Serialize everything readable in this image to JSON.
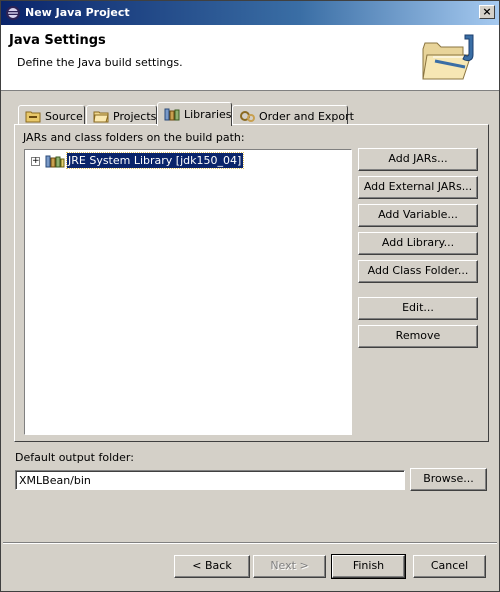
{
  "window": {
    "title": "New Java Project",
    "close_glyph": "×"
  },
  "header": {
    "title": "Java Settings",
    "description": "Define the Java build settings.",
    "icon": "java-project-folder-icon"
  },
  "tabs": [
    {
      "label": "Source",
      "icon": "source-folder-icon",
      "active": false
    },
    {
      "label": "Projects",
      "icon": "projects-icon",
      "active": false
    },
    {
      "label": "Libraries",
      "icon": "libraries-icon",
      "active": true
    },
    {
      "label": "Order and Export",
      "icon": "order-export-icon",
      "active": false
    }
  ],
  "build_path": {
    "label": "JARs and class folders on the build path:",
    "items": [
      {
        "label": "JRE System Library [jdk150_04]",
        "expanded": false,
        "selected": true
      }
    ]
  },
  "side_buttons": {
    "add_jars": "Add JARs...",
    "add_external_jars": "Add External JARs...",
    "add_variable": "Add Variable...",
    "add_library": "Add Library...",
    "add_class_folder": "Add Class Folder...",
    "edit": "Edit...",
    "remove": "Remove"
  },
  "output": {
    "label": "Default output folder:",
    "value": "XMLBean/bin",
    "browse": "Browse..."
  },
  "footer": {
    "back": "< Back",
    "next": "Next >",
    "finish": "Finish",
    "cancel": "Cancel"
  },
  "colors": {
    "titlebar": "#0a246a",
    "selection": "#0a246a",
    "face": "#d4d0c8"
  }
}
